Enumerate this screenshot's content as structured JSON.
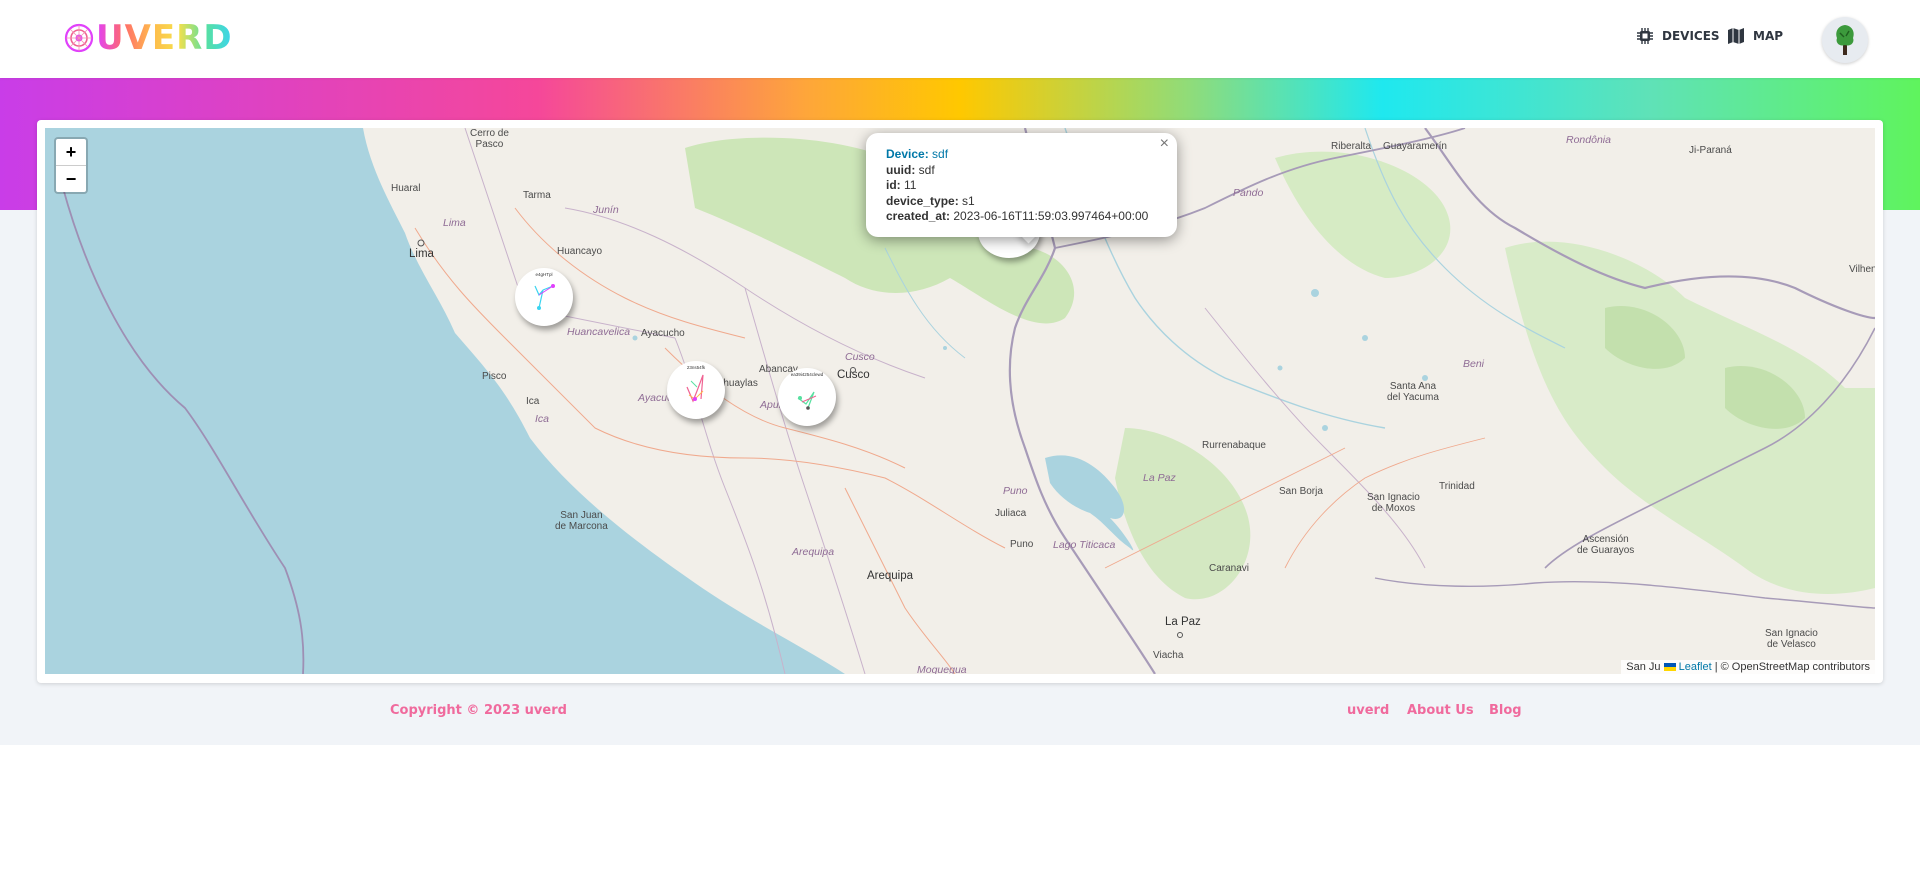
{
  "header": {
    "logo_text": "UVERD",
    "nav": [
      {
        "label": "DEVICES",
        "icon": "chip-icon"
      },
      {
        "label": "MAP",
        "icon": "map-icon"
      }
    ],
    "avatar_icon": "tree-avatar-icon"
  },
  "map": {
    "zoom_in": "+",
    "zoom_out": "−",
    "places": [
      {
        "name": "Cerro de\nPasco"
      },
      {
        "name": "Huaral"
      },
      {
        "name": "Tarma"
      },
      {
        "name": "Junín"
      },
      {
        "name": "Lima"
      },
      {
        "name": "Lima"
      },
      {
        "name": "Huancayo"
      },
      {
        "name": "Huancavelica"
      },
      {
        "name": "Ayacucho"
      },
      {
        "name": "Abancay"
      },
      {
        "name": "Andahuaylas"
      },
      {
        "name": "Cusco"
      },
      {
        "name": "Cusco"
      },
      {
        "name": "Pisco"
      },
      {
        "name": "Ica"
      },
      {
        "name": "Ica"
      },
      {
        "name": "Ayacucho"
      },
      {
        "name": "Apurímac"
      },
      {
        "name": "San Juan\nde Marcona"
      },
      {
        "name": "Arequipa"
      },
      {
        "name": "Arequipa"
      },
      {
        "name": "Moquegua"
      },
      {
        "name": "Puno"
      },
      {
        "name": "Juliaca"
      },
      {
        "name": "Puno"
      },
      {
        "name": "Lago Titicaca"
      },
      {
        "name": "La Paz"
      },
      {
        "name": "La Paz"
      },
      {
        "name": "Viacha"
      },
      {
        "name": "Caranavi"
      },
      {
        "name": "Rurrenabaque"
      },
      {
        "name": "San Borja"
      },
      {
        "name": "San Ignacio\nde Moxos"
      },
      {
        "name": "Trinidad"
      },
      {
        "name": "Santa Ana\ndel Yacuma"
      },
      {
        "name": "Beni"
      },
      {
        "name": "Pando"
      },
      {
        "name": "Riberalta"
      },
      {
        "name": "Guayaramerín"
      },
      {
        "name": "Rondônia"
      },
      {
        "name": "Ji-Paraná"
      },
      {
        "name": "Vilhen"
      },
      {
        "name": "Ascensión\nde Guarayos"
      },
      {
        "name": "San Ignacio\nde Velasco"
      }
    ],
    "markers": [
      {
        "label": "e4gHTpl"
      },
      {
        "label": "23ns54fk"
      },
      {
        "label": "ea39i4254clewd"
      },
      {
        "label": ""
      }
    ],
    "popup": {
      "close": "×",
      "device_label": "Device:",
      "device_value": "sdf",
      "uuid_label": "uuid:",
      "uuid_value": "sdf",
      "id_label": "id:",
      "id_value": "11",
      "type_label": "device_type:",
      "type_value": "s1",
      "created_label": "created_at:",
      "created_value": "2023-06-16T11:59:03.997464+00:00"
    },
    "attribution": {
      "prefix": "San Ju",
      "leaflet": "Leaflet",
      "rest": " | © OpenStreetMap contributors"
    }
  },
  "footer": {
    "copyright": "Copyright © 2023 uverd",
    "links": [
      "uverd",
      "About Us",
      "Blog"
    ]
  }
}
